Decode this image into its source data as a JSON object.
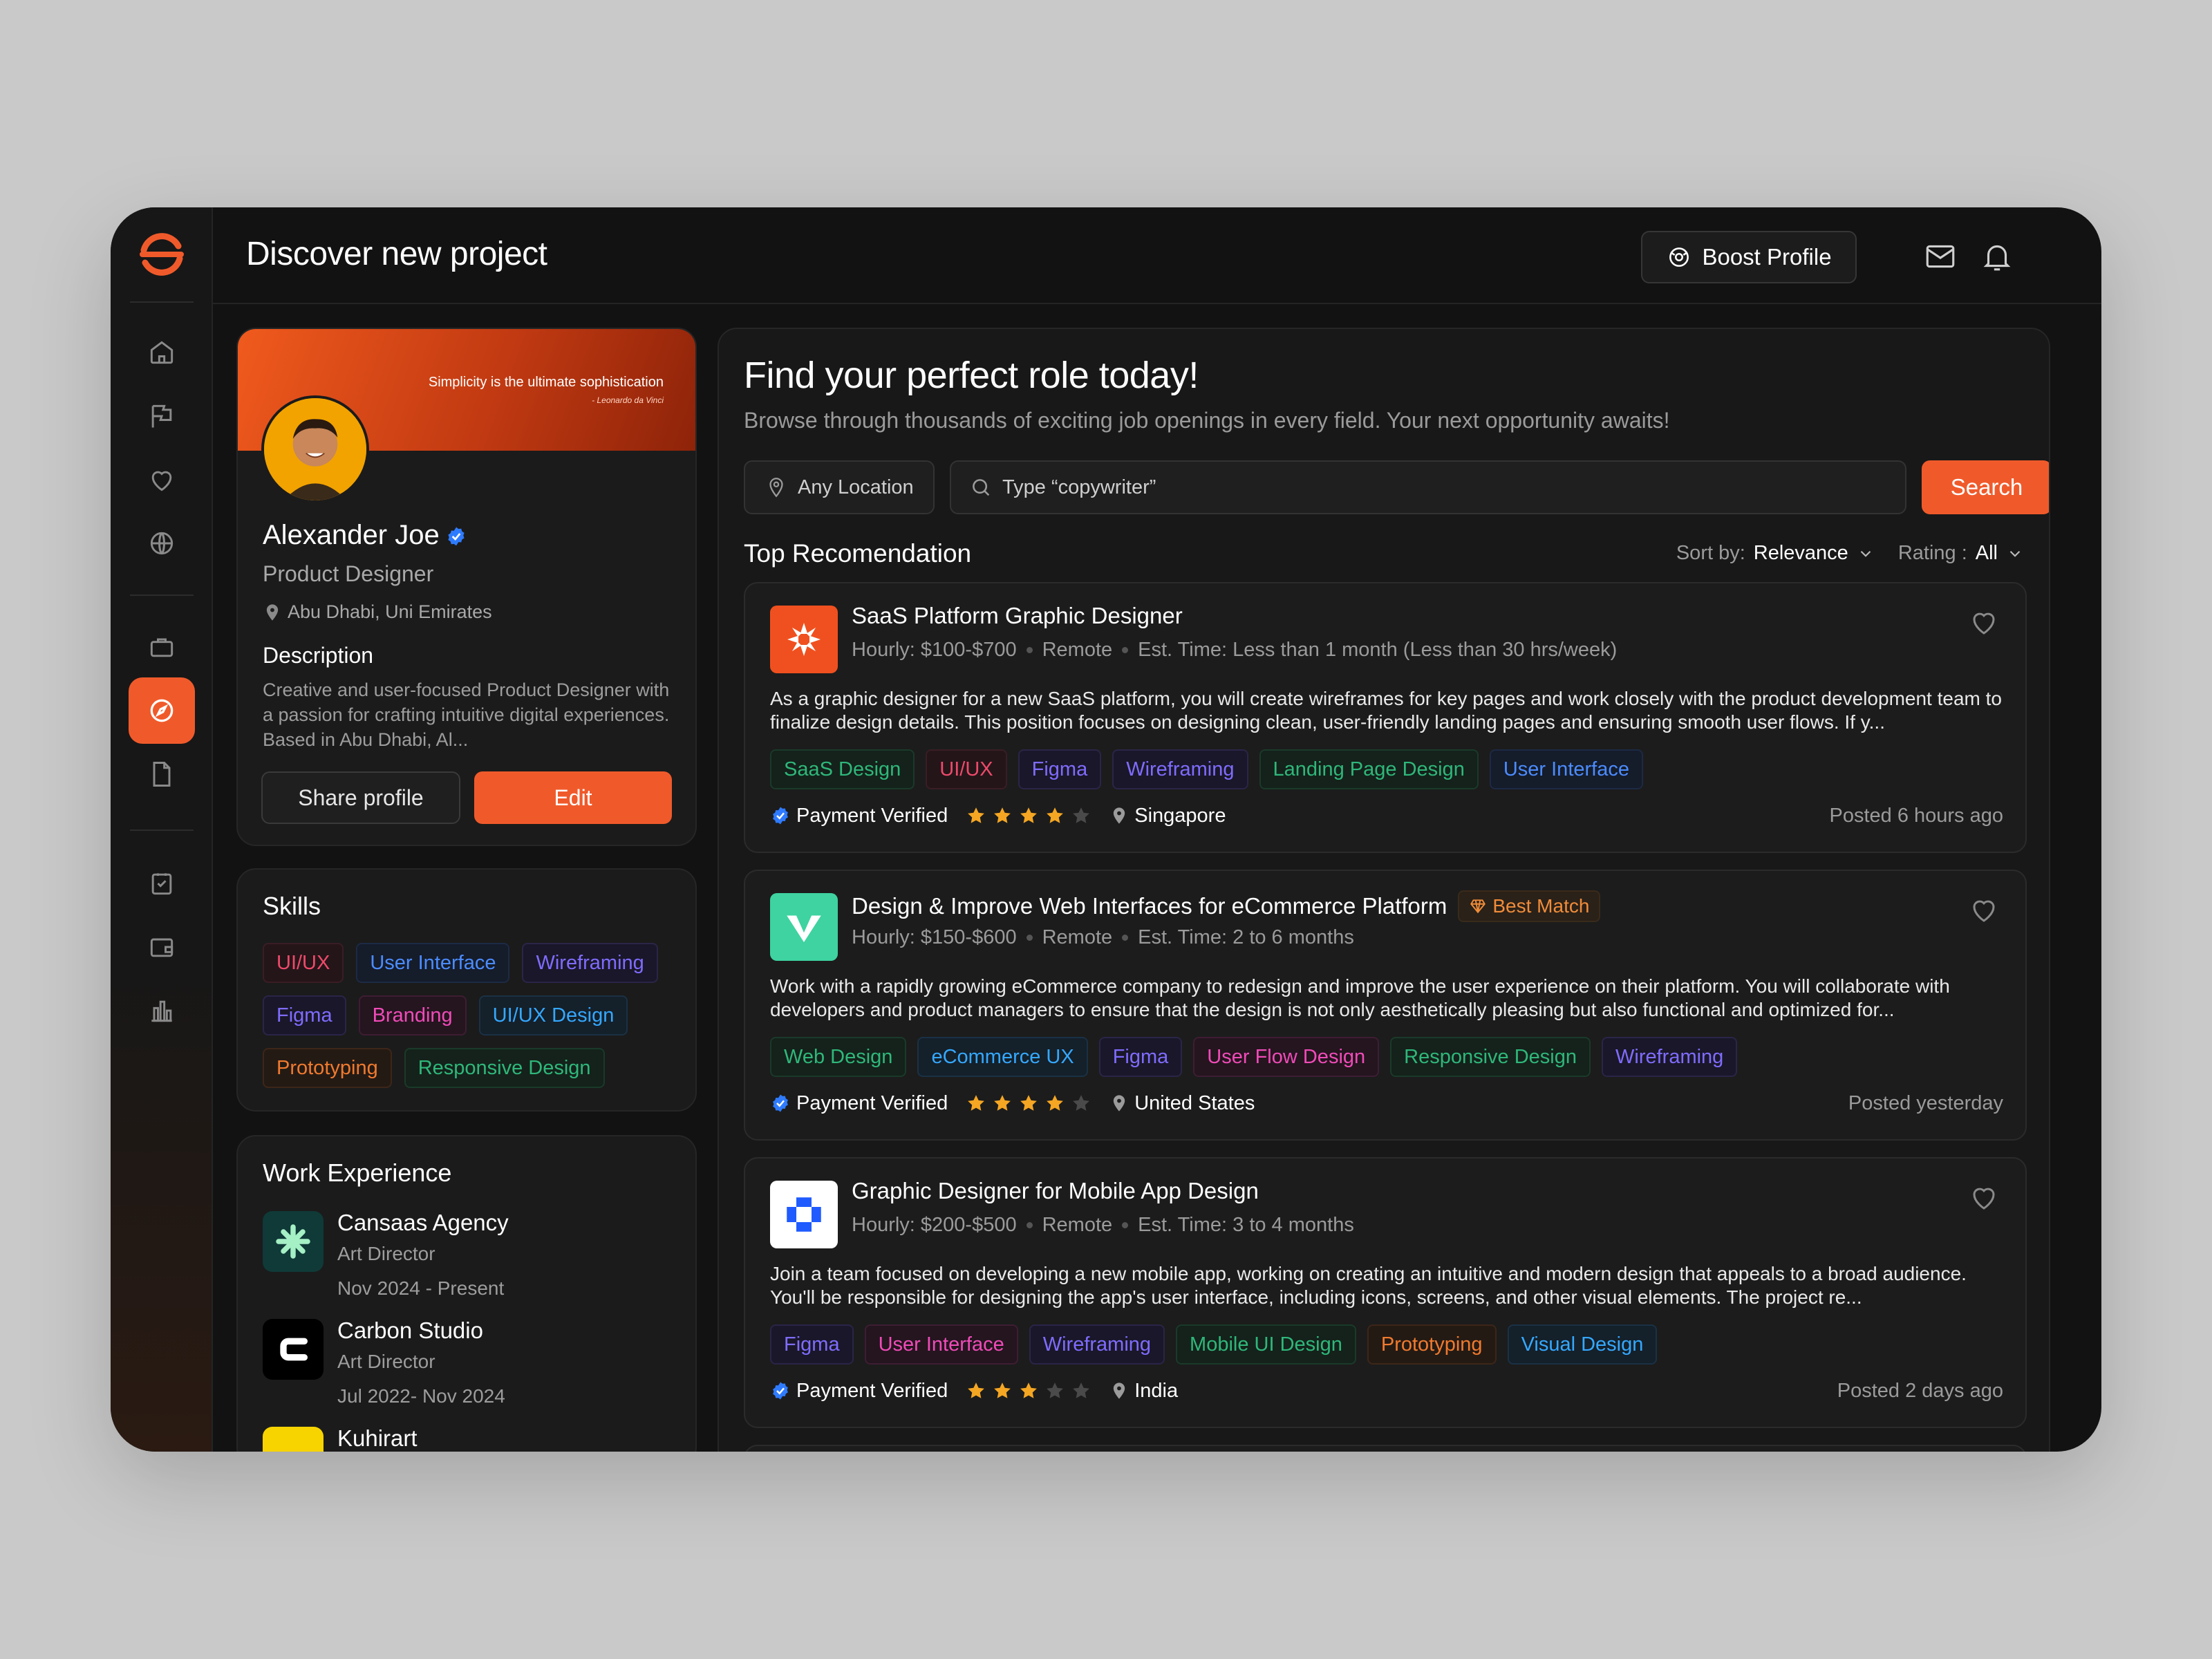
{
  "header": {
    "title": "Discover new project",
    "boost_label": "Boost Profile"
  },
  "sidebar": {
    "items": [
      "home-icon",
      "flag-icon",
      "heart-icon",
      "globe-icon",
      "briefcase-icon",
      "compass-icon",
      "document-icon",
      "checklist-icon",
      "wallet-icon",
      "chart-icon"
    ],
    "active": "compass-icon"
  },
  "profile": {
    "quote": "Simplicity is the ultimate sophistication",
    "quote_author": "- Leonardo da Vinci",
    "name": "Alexander Joe",
    "role": "Product Designer",
    "location": "Abu Dhabi, Uni Emirates",
    "description_title": "Description",
    "description": "Creative and user-focused Product Designer with a passion for crafting intuitive digital experiences. Based in Abu Dhabi, Al...",
    "share_label": "Share profile",
    "edit_label": "Edit"
  },
  "skills": {
    "title": "Skills",
    "items": [
      {
        "label": "UI/UX"
      },
      {
        "label": "User Interface"
      },
      {
        "label": "Wireframing"
      },
      {
        "label": "Figma"
      },
      {
        "label": "Branding"
      },
      {
        "label": "UI/UX Design"
      },
      {
        "label": "Prototyping"
      },
      {
        "label": "Responsive Design"
      }
    ]
  },
  "work": {
    "title": "Work Experience",
    "items": [
      {
        "company": "Cansaas Agency",
        "role": "Art Director",
        "date": "Nov 2024 - Present"
      },
      {
        "company": "Carbon Studio",
        "role": "Art Director",
        "date": "Jul 2022- Nov 2024"
      },
      {
        "company": "Kuhirart",
        "role": "",
        "date": ""
      }
    ]
  },
  "main": {
    "title": "Find your perfect role today!",
    "subtitle": "Browse through thousands of exciting job openings in every field. Your next opportunity awaits!",
    "location_placeholder": "Any Location",
    "search_placeholder": "Type “copywriter”",
    "search_label": "Search",
    "rec_title": "Top Recomendation",
    "sort_label": "Sort by:",
    "sort_value": "Relevance",
    "rating_label": "Rating :",
    "rating_value": "All"
  },
  "jobs": [
    {
      "title": "SaaS Platform Graphic Designer",
      "hourly": "Hourly: $100-$700",
      "mode": "Remote",
      "est": "Est. Time: Less than 1 month (Less than 30 hrs/week)",
      "desc": "As a graphic designer for a new SaaS platform, you will create wireframes for key pages and work closely with the product development team to finalize design details. This position focuses on designing clean, user-friendly landing pages and ensuring smooth user flows. If y...",
      "tags": [
        "SaaS Design",
        "UI/UX",
        "Figma",
        "Wireframing",
        "Landing Page Design",
        "User Interface"
      ],
      "verified": "Payment Verified",
      "rating": 4,
      "location": "Singapore",
      "posted": "Posted 6 hours ago",
      "badge": ""
    },
    {
      "title": "Design & Improve Web Interfaces for eCommerce Platform",
      "hourly": "Hourly: $150-$600",
      "mode": "Remote",
      "est": "Est. Time: 2 to 6 months",
      "desc": "Work with a rapidly growing eCommerce company to redesign and improve the user experience on their platform. You will collaborate with developers and product managers to ensure that the design is not only aesthetically pleasing but also functional and optimized for...",
      "tags": [
        "Web Design",
        "eCommerce UX",
        "Figma",
        "User Flow Design",
        "Responsive Design",
        "Wireframing"
      ],
      "verified": "Payment Verified",
      "rating": 4,
      "location": "United States",
      "posted": "Posted yesterday",
      "badge": "Best Match"
    },
    {
      "title": "Graphic Designer for Mobile App Design",
      "hourly": "Hourly: $200-$500",
      "mode": "Remote",
      "est": "Est. Time: 3 to 4 months",
      "desc": "Join a team focused on developing a new mobile app, working on creating an intuitive and modern design that appeals to a broad audience. You'll be responsible for designing the app's user interface, including icons, screens, and other visual elements. The project re...",
      "tags": [
        "Figma",
        "User Interface",
        "Wireframing",
        "Mobile UI Design",
        "Prototyping",
        "Visual Design"
      ],
      "verified": "Payment Verified",
      "rating": 3,
      "location": "India",
      "posted": "Posted 2 days ago",
      "badge": ""
    }
  ]
}
